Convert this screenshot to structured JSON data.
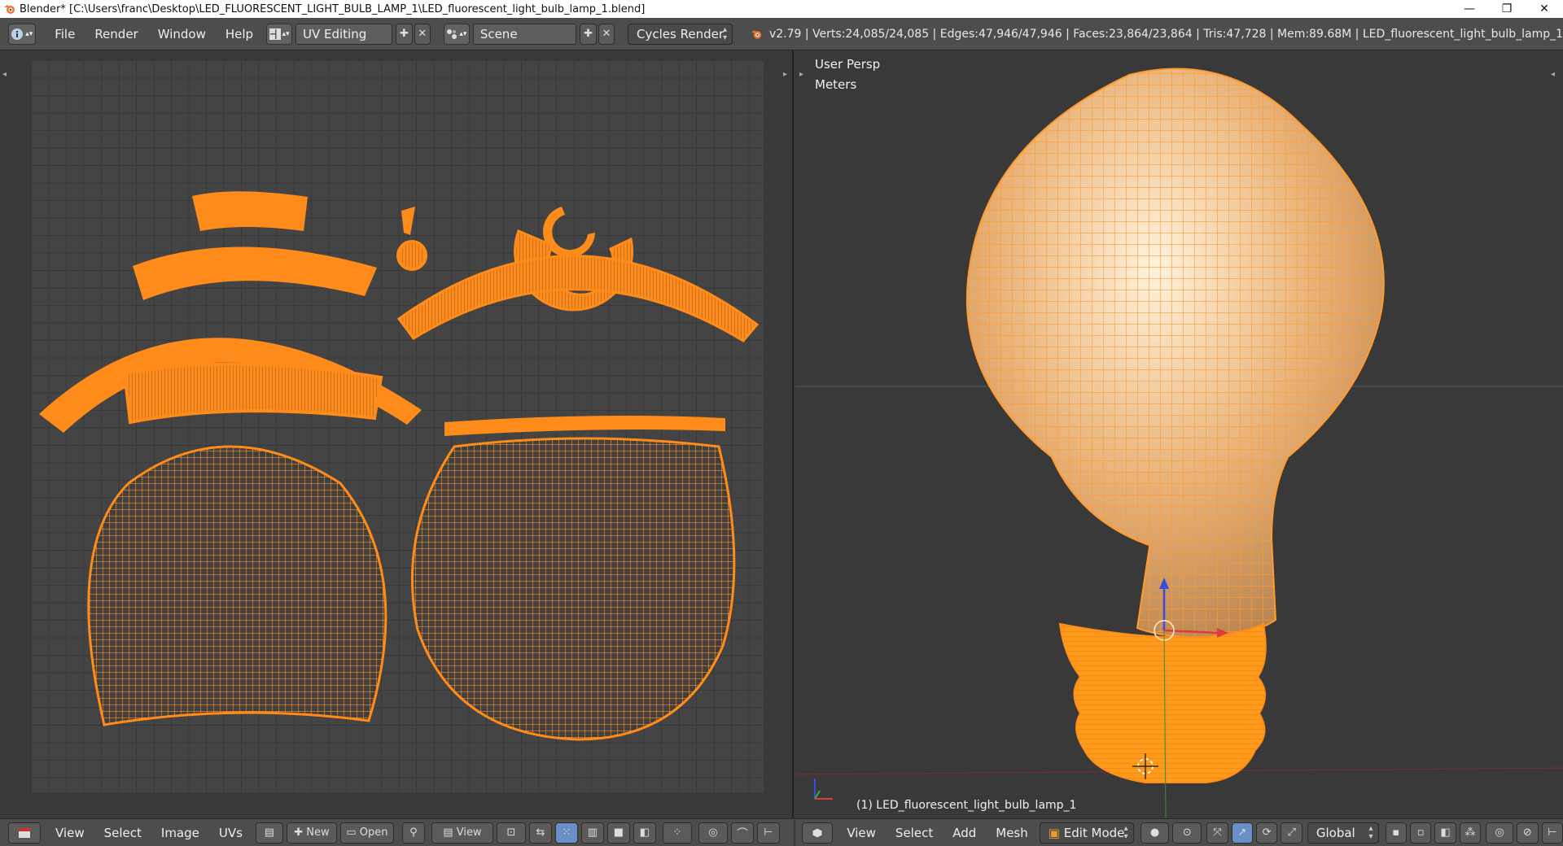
{
  "window": {
    "title": "Blender* [C:\\Users\\franc\\Desktop\\LED_FLUORESCENT_LIGHT_BULB_LAMP_1\\LED_fluorescent_light_bulb_lamp_1.blend]",
    "minimize": "—",
    "restore": "❐",
    "close": "✕"
  },
  "topbar": {
    "menus": [
      "File",
      "Render",
      "Window",
      "Help"
    ],
    "layout_name": "UV Editing",
    "scene_name": "Scene",
    "render_engine": "Cycles Render",
    "stats": "v2.79 | Verts:24,085/24,085 | Edges:47,946/47,946 | Faces:23,864/23,864 | Tris:47,728 | Mem:89.68M | LED_fluorescent_light_bulb_lamp_1"
  },
  "viewport": {
    "view_label": "User Persp",
    "units_label": "Meters",
    "object_label": "(1) LED_fluorescent_light_bulb_lamp_1",
    "menus": [
      "View",
      "Select",
      "Add",
      "Mesh"
    ],
    "mode": "Edit Mode",
    "orientation": "Global"
  },
  "uv_editor": {
    "menus": [
      "View",
      "Select",
      "Image",
      "UVs"
    ],
    "new_label": "New",
    "open_label": "Open",
    "view_label": "View"
  },
  "colors": {
    "accent_orange": "#ff8c1a",
    "header": "#4d4d4d",
    "background": "#393939",
    "grid": "#444444"
  }
}
